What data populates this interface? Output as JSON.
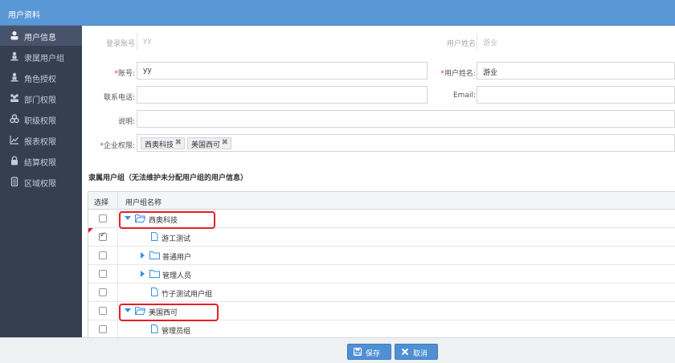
{
  "window": {
    "title": "用户资料"
  },
  "sidebar": {
    "items": [
      {
        "label": "用户信息",
        "icon": "user-icon",
        "active": true
      },
      {
        "label": "隶属用户组",
        "icon": "user-group-icon",
        "active": false
      },
      {
        "label": "角色授权",
        "icon": "role-icon",
        "active": false
      },
      {
        "label": "部门权限",
        "icon": "department-icon",
        "active": false
      },
      {
        "label": "职级权限",
        "icon": "rank-icon",
        "active": false
      },
      {
        "label": "报表权限",
        "icon": "chart-icon",
        "active": false
      },
      {
        "label": "结算权限",
        "icon": "lock-icon",
        "active": false
      },
      {
        "label": "区域权限",
        "icon": "region-icon",
        "active": false
      }
    ]
  },
  "form": {
    "login_account": {
      "label": "登录账号",
      "value": "yy"
    },
    "user_name_top": {
      "label": "用户姓名",
      "value": "游业"
    },
    "account": {
      "label": "账号:",
      "value": "yy",
      "required": true
    },
    "user_name": {
      "label": "用户姓名:",
      "value": "游业",
      "required": true
    },
    "phone": {
      "label": "联系电话:",
      "value": ""
    },
    "email": {
      "label": "Email:",
      "value": ""
    },
    "description": {
      "label": "说明:",
      "value": ""
    },
    "company_permission": {
      "label": "企业权限:",
      "required": true,
      "tags": [
        "西奥科技",
        "美国西可"
      ]
    },
    "required_mark": "*",
    "tag_remove": "✖"
  },
  "group_section": {
    "title": "隶属用户组（无法维护未分配用户组的用户信息）",
    "columns": [
      "选择",
      "用户组名称"
    ],
    "rows": [
      {
        "name": "西奥科技",
        "type": "folder-open",
        "expand": "down",
        "checked": false,
        "highlight": true
      },
      {
        "name": "游工测试",
        "type": "file",
        "expand": "",
        "checked": true,
        "highlight": false
      },
      {
        "name": "普通用户",
        "type": "folder",
        "expand": "right",
        "checked": false,
        "highlight": false
      },
      {
        "name": "管理人员",
        "type": "folder",
        "expand": "right",
        "checked": false,
        "highlight": false
      },
      {
        "name": "竹子测试用户组",
        "type": "file",
        "expand": "",
        "checked": false,
        "highlight": false
      },
      {
        "name": "美国西可",
        "type": "folder-open",
        "expand": "down",
        "checked": false,
        "highlight": true
      },
      {
        "name": "管理员组",
        "type": "file",
        "expand": "",
        "checked": false,
        "highlight": false
      }
    ]
  },
  "footer": {
    "save_label": "保存",
    "cancel_label": "取消"
  },
  "colors": {
    "titlebar": "#5a97d6",
    "sidebar": "#353f4f",
    "accent": "#4f8fd4",
    "highlight": "#e0202a"
  }
}
